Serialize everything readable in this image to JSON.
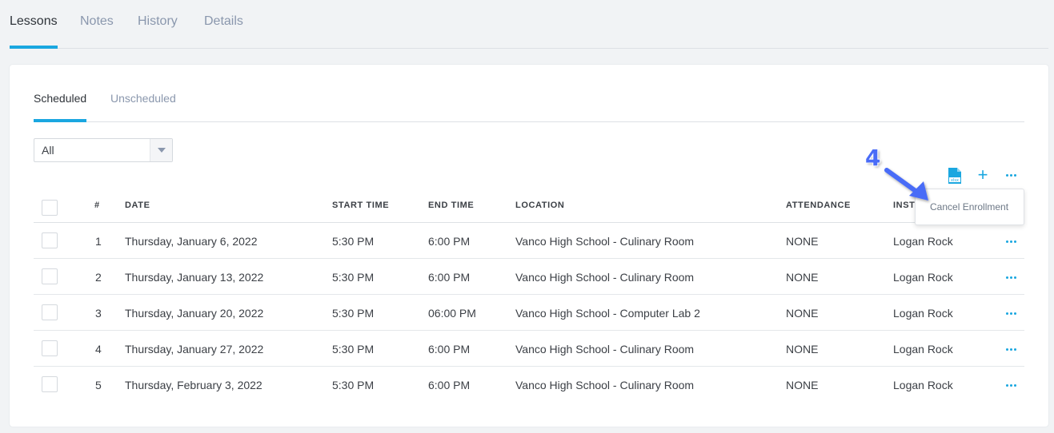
{
  "top_tabs": [
    {
      "label": "Lessons",
      "active": true
    },
    {
      "label": "Notes",
      "active": false
    },
    {
      "label": "History",
      "active": false
    },
    {
      "label": "Details",
      "active": false
    }
  ],
  "sub_tabs": [
    {
      "label": "Scheduled",
      "active": true
    },
    {
      "label": "Unscheduled",
      "active": false
    }
  ],
  "filter": {
    "selected": "All"
  },
  "toolbar": {
    "export_icon": "xlsx-file-icon",
    "add_icon": "plus-icon",
    "more_icon": "more-horizontal-icon"
  },
  "table": {
    "columns": [
      "#",
      "DATE",
      "START TIME",
      "END TIME",
      "LOCATION",
      "ATTENDANCE",
      "INST"
    ],
    "rows": [
      {
        "num": "1",
        "date": "Thursday, January 6, 2022",
        "start": "5:30 PM",
        "end": "6:00 PM",
        "location": "Vanco High School - Culinary Room",
        "attendance": "NONE",
        "instructor": "Logan Rock"
      },
      {
        "num": "2",
        "date": "Thursday, January 13, 2022",
        "start": "5:30 PM",
        "end": "6:00 PM",
        "location": "Vanco High School - Culinary Room",
        "attendance": "NONE",
        "instructor": "Logan Rock"
      },
      {
        "num": "3",
        "date": "Thursday, January 20, 2022",
        "start": "5:30 PM",
        "end": "06:00 PM",
        "location": "Vanco High School - Computer Lab 2",
        "attendance": "NONE",
        "instructor": "Logan Rock"
      },
      {
        "num": "4",
        "date": "Thursday, January 27, 2022",
        "start": "5:30 PM",
        "end": "6:00 PM",
        "location": "Vanco High School - Culinary Room",
        "attendance": "NONE",
        "instructor": "Logan Rock"
      },
      {
        "num": "5",
        "date": "Thursday, February 3, 2022",
        "start": "5:30 PM",
        "end": "6:00 PM",
        "location": "Vanco High School - Culinary Room",
        "attendance": "NONE",
        "instructor": "Logan Rock"
      }
    ]
  },
  "dropdown": {
    "item": "Cancel Enrollment"
  },
  "annotation": {
    "number": "4"
  },
  "colors": {
    "accent": "#1aa7e0",
    "annotation": "#4a6cf7",
    "muted_text": "#8a97ad"
  }
}
